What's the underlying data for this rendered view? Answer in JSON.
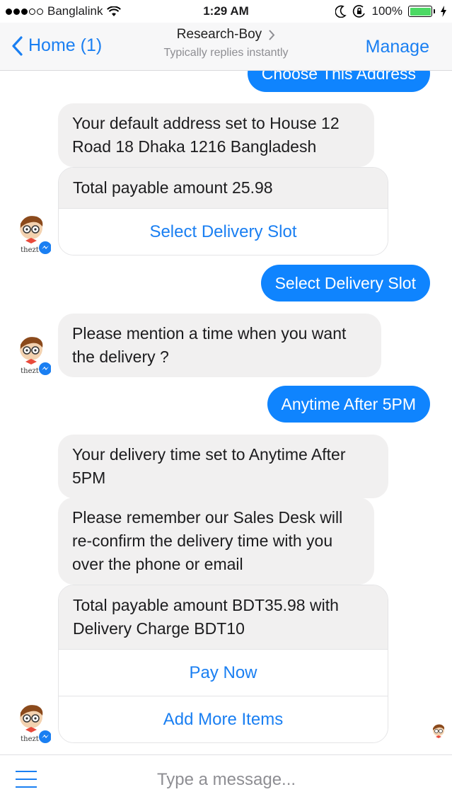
{
  "status_bar": {
    "carrier": "Banglalink",
    "time": "1:29 AM",
    "battery": "100%",
    "battery_level": 1.0,
    "signal_filled": 3,
    "signal_total": 5
  },
  "nav": {
    "back_label": "Home (1)",
    "title": "Research-Boy",
    "subtitle": "Typically replies instantly",
    "manage_label": "Manage"
  },
  "messages": {
    "choose_address": "Choose This Address",
    "default_address": "Your default address set to House 12 Road 18 Dhaka 1216 Bangladesh",
    "total_payable_1": "Total payable amount 25.98",
    "select_slot_button": "Select Delivery Slot",
    "select_slot_reply": "Select Delivery Slot",
    "mention_time": "Please mention a time when you want the delivery ?",
    "anytime_reply": "Anytime After 5PM",
    "time_set": "Your delivery time set to Anytime After 5PM",
    "reconfirm": "Please remember our Sales Desk will re-confirm the delivery time with you over the phone or email",
    "total_payable_2": "Total payable amount BDT35.98 with Delivery Charge BDT10",
    "pay_now_button": "Pay Now",
    "add_more_button": "Add More Items"
  },
  "avatar": {
    "label": "thezt"
  },
  "composer": {
    "placeholder": "Type a message..."
  },
  "colors": {
    "accent": "#1a7ff2",
    "outgoing_bubble": "#0f84fe",
    "incoming_bubble": "#f1f0f0",
    "battery": "#4cd964"
  },
  "icons": [
    "wifi-icon",
    "moon-icon",
    "orientation-lock-icon",
    "battery-icon",
    "charging-icon",
    "chevron-left-icon",
    "chevron-right-icon",
    "messenger-badge-icon",
    "hamburger-menu-icon"
  ]
}
